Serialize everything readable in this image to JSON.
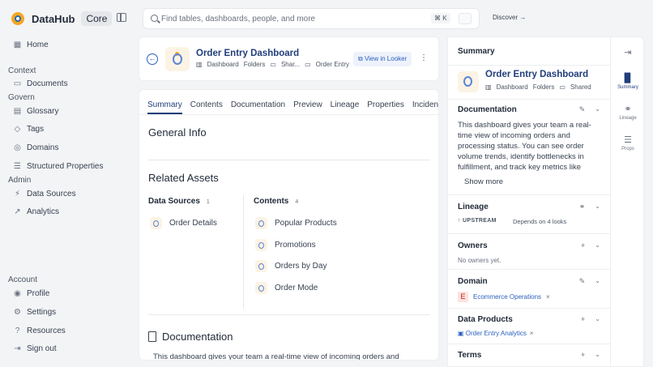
{
  "app": {
    "name": "DataHub",
    "edition": "Core"
  },
  "search": {
    "placeholder": "Find tables, dashboards, people, and more",
    "shortcut": "⌘ K"
  },
  "discover_label": "Discover →",
  "nav": {
    "home": "Home",
    "context_label": "Context",
    "documents": "Documents",
    "govern_label": "Govern",
    "glossary": "Glossary",
    "tags": "Tags",
    "domains": "Domains",
    "structured_properties": "Structured Properties",
    "admin_label": "Admin",
    "data_sources": "Data Sources",
    "analytics": "Analytics",
    "account_label": "Account",
    "profile": "Profile",
    "settings": "Settings",
    "resources": "Resources",
    "sign_out": "Sign out"
  },
  "entity": {
    "title": "Order Entry Dashboard",
    "type": "Dashboard",
    "folders": "Folders",
    "shared": "Shar...",
    "folder_name": "Order Entry",
    "view_button": "View in Looker"
  },
  "tabs": [
    "Summary",
    "Contents",
    "Documentation",
    "Preview",
    "Lineage",
    "Properties",
    "Incidents"
  ],
  "main": {
    "general_info": "General Info",
    "related_assets": "Related Assets",
    "data_sources_title": "Data Sources",
    "data_sources_count": "1",
    "data_sources": [
      "Order Details"
    ],
    "contents_title": "Contents",
    "contents_count": "4",
    "contents": [
      "Popular Products",
      "Promotions",
      "Orders by Day",
      "Order Mode"
    ],
    "documentation_title": "Documentation",
    "documentation_preview": "This dashboard gives your team a real-time view of incoming orders and"
  },
  "summary": {
    "header": "Summary",
    "title": "Order Entry Dashboard",
    "type": "Dashboard",
    "folders": "Folders",
    "shared": "Shared",
    "documentation_title": "Documentation",
    "documentation_text": "This dashboard gives your team a real-time view of incoming orders and processing status. You can see order volume trends, identify bottlenecks in fulfillment, and track key metrics like",
    "show_more": "Show more",
    "lineage_title": "Lineage",
    "upstream": "UPSTREAM",
    "depends_on": "Depends on 4 looks",
    "owners_title": "Owners",
    "no_owners": "No owners yet.",
    "domain_title": "Domain",
    "domain_letter": "E",
    "domain_name": "Ecommerce Operations",
    "data_products_title": "Data Products",
    "data_product_name": "Order Entry Analytics",
    "terms_title": "Terms"
  },
  "rail": {
    "summary": "Summary",
    "lineage": "Lineage",
    "props": "Props"
  }
}
